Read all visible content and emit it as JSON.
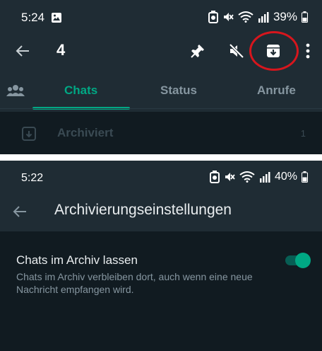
{
  "top": {
    "status": {
      "time": "5:24",
      "battery": "39%"
    },
    "action_bar": {
      "selected_count": "4",
      "icons": [
        "back-arrow-icon",
        "pin-icon",
        "mute-icon",
        "archive-icon",
        "more-vert-icon"
      ]
    },
    "tabs": [
      {
        "label": "Chats",
        "active": true
      },
      {
        "label": "Status",
        "active": false
      },
      {
        "label": "Anrufe",
        "active": false
      }
    ],
    "archived_row": {
      "label": "Archiviert",
      "count": "1"
    },
    "highlight_color": "#d7161d"
  },
  "bottom": {
    "status": {
      "time": "5:22",
      "battery": "40%"
    },
    "title": "Archivierungseinstellungen",
    "setting": {
      "title": "Chats im Archiv lassen",
      "description": "Chats im Archiv verbleiben dort, auch wenn eine neue Nachricht empfangen wird.",
      "enabled": true
    }
  },
  "colors": {
    "accent": "#00a884",
    "header": "#1f2c34",
    "background": "#111b21"
  }
}
